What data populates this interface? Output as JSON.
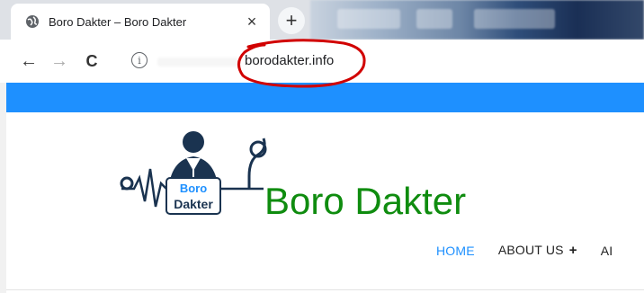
{
  "browser": {
    "tab_title": "Boro Dakter – Boro Dakter",
    "tab_close": "×",
    "new_tab": "+",
    "back": "←",
    "forward": "→",
    "reload": "C",
    "info": "i",
    "url": "borodakter.info"
  },
  "site": {
    "brand_name": "Boro Dakter",
    "logo_text_line1": "Boro",
    "logo_text_line2": "Dakter",
    "nav": [
      {
        "label": "HOME"
      },
      {
        "label": "ABOUT US",
        "suffix": "+"
      },
      {
        "label": "AI"
      }
    ]
  },
  "colors": {
    "topbar": "#1e90ff",
    "brand": "#0f8c0f",
    "nav_active": "#1e90ff",
    "annotation": "#d10000"
  }
}
